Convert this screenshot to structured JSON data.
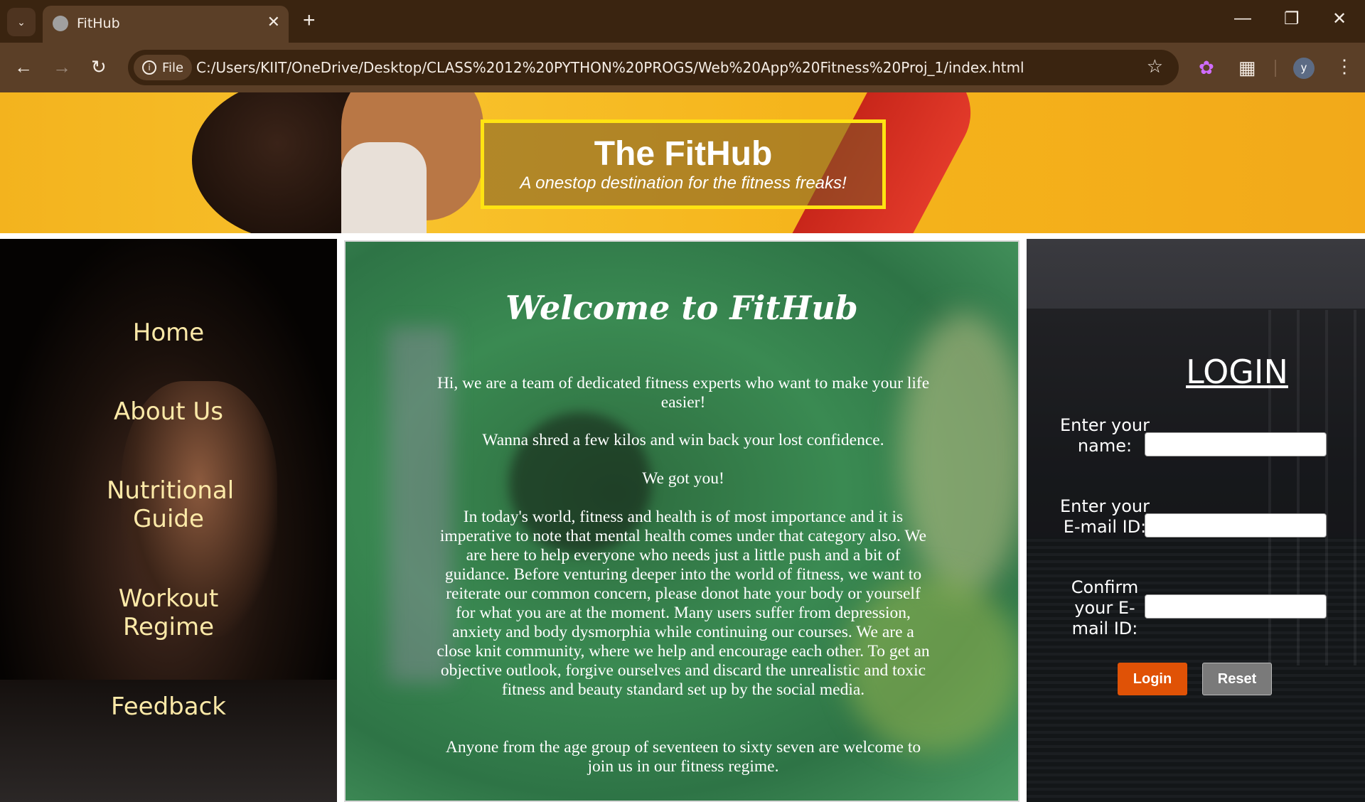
{
  "browser": {
    "tab_title": "FitHub",
    "file_chip": "File",
    "url": "C:/Users/KIIT/OneDrive/Desktop/CLASS%2012%20PYTHON%20PROGS/Web%20App%20Fitness%20Proj_1/index.html",
    "profile_initial": "y",
    "icons": [
      "tab-list-icon",
      "close-icon",
      "new-tab-icon",
      "minimize-icon",
      "restore-icon",
      "window-close-icon",
      "back-icon",
      "forward-icon",
      "reload-icon",
      "info-icon",
      "star-icon",
      "extension-icon",
      "puzzle-icon",
      "menu-icon"
    ]
  },
  "header": {
    "title": "The FitHub",
    "subtitle": "A onestop destination for the fitness freaks!"
  },
  "sidebar": {
    "items": [
      {
        "label": "Home"
      },
      {
        "label": "About Us"
      },
      {
        "label": "Nutritional Guide"
      },
      {
        "label": "Workout Regime"
      },
      {
        "label": "Feedback"
      }
    ]
  },
  "main": {
    "heading": "Welcome to FitHub",
    "paragraphs": [
      "Hi, we are a team of dedicated fitness experts who want to make your life easier!",
      "Wanna shred a few kilos and win back your lost confidence.",
      "We got you!",
      "In today's world, fitness and health is of most importance and it is imperative to note that mental health comes under that category also. We are here to help everyone who needs just a little push and a bit of guidance. Before venturing deeper into the world of fitness, we want to reiterate our common concern, please donot hate your body or yourself for what you are at the moment. Many users suffer from depression, anxiety and body dysmorphia while continuing our courses. We are a close knit community, where we help and encourage each other. To get an objective outlook, forgive ourselves and discard the unrealistic and toxic fitness and beauty standard set up by the social media.",
      "Anyone from the age group of seventeen to sixty seven are welcome to join us in our fitness regime."
    ]
  },
  "login": {
    "title": "LOGIN",
    "fields": [
      {
        "label": "Enter your name:",
        "value": ""
      },
      {
        "label": "Enter your E-mail ID:",
        "value": ""
      },
      {
        "label": "Confirm your E-mail ID:",
        "value": ""
      }
    ],
    "login_button": "Login",
    "reset_button": "Reset",
    "colors": {
      "login_button": "#e05206",
      "reset_button": "#7a7a7a"
    }
  },
  "colors": {
    "header_bg": "#f5b41b",
    "title_border": "#ffe312",
    "nav_text": "#fce9a8",
    "browser_frame": "#3a2410"
  }
}
